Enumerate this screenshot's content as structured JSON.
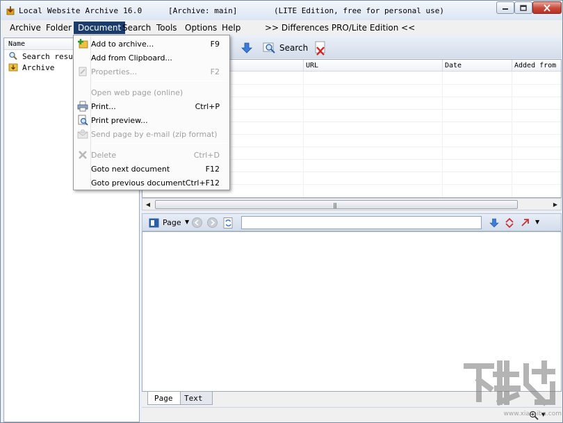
{
  "window": {
    "title": "Local Website Archive 16.0",
    "archive_label": "[Archive: main]",
    "edition_label": "(LITE Edition, free for personal use)"
  },
  "menubar": {
    "items": [
      {
        "label": "Archive",
        "key": "A"
      },
      {
        "label": "Folder",
        "key": "F"
      },
      {
        "label": "Document",
        "key": "D"
      },
      {
        "label": "Search",
        "key": "S"
      },
      {
        "label": "Tools",
        "key": "T"
      },
      {
        "label": "Options",
        "key": "O"
      },
      {
        "label": "Help",
        "key": "H"
      }
    ],
    "differences_link": ">> Differences PRO/Lite Edition <<"
  },
  "tree": {
    "header": "Name",
    "items": [
      {
        "label": "Search resul",
        "icon": "magnifier-icon"
      },
      {
        "label": "Archive",
        "icon": "archive-folder-icon"
      }
    ]
  },
  "toolbar": {
    "search_label": "Search"
  },
  "table": {
    "columns": [
      "URL",
      "Date",
      "Added from"
    ]
  },
  "preview": {
    "page_label": "Page",
    "url_value": ""
  },
  "tabs": [
    "Page",
    "Text"
  ],
  "document_menu": {
    "items": [
      {
        "label": "Add to archive...",
        "shortcut": "F9",
        "enabled": true,
        "icon": "add-archive-icon"
      },
      {
        "label": "Add from Clipboard...",
        "shortcut": "",
        "enabled": true,
        "icon": ""
      },
      {
        "label": "Properties...",
        "shortcut": "F2",
        "enabled": false,
        "icon": "properties-icon"
      },
      {
        "label": "Open web page (online)",
        "shortcut": "",
        "enabled": false,
        "icon": ""
      },
      {
        "label": "Print...",
        "shortcut": "Ctrl+P",
        "enabled": true,
        "icon": "printer-icon"
      },
      {
        "label": "Print preview...",
        "shortcut": "",
        "enabled": true,
        "icon": "print-preview-icon"
      },
      {
        "label": "Send page by e-mail (zip format)",
        "shortcut": "",
        "enabled": false,
        "icon": "email-icon"
      },
      {
        "label": "Delete",
        "shortcut": "Ctrl+D",
        "enabled": false,
        "icon": "delete-icon"
      },
      {
        "label": "Goto next document",
        "shortcut": "F12",
        "enabled": true,
        "icon": ""
      },
      {
        "label": "Goto previous document",
        "shortcut": "Ctrl+F12",
        "enabled": true,
        "icon": ""
      }
    ]
  },
  "watermark": {
    "url": "www.xiazaiba.com"
  },
  "colors": {
    "menu_active": "#1a3d6e",
    "accent_blue": "#3b7dd8",
    "delete_red": "#d22222"
  }
}
